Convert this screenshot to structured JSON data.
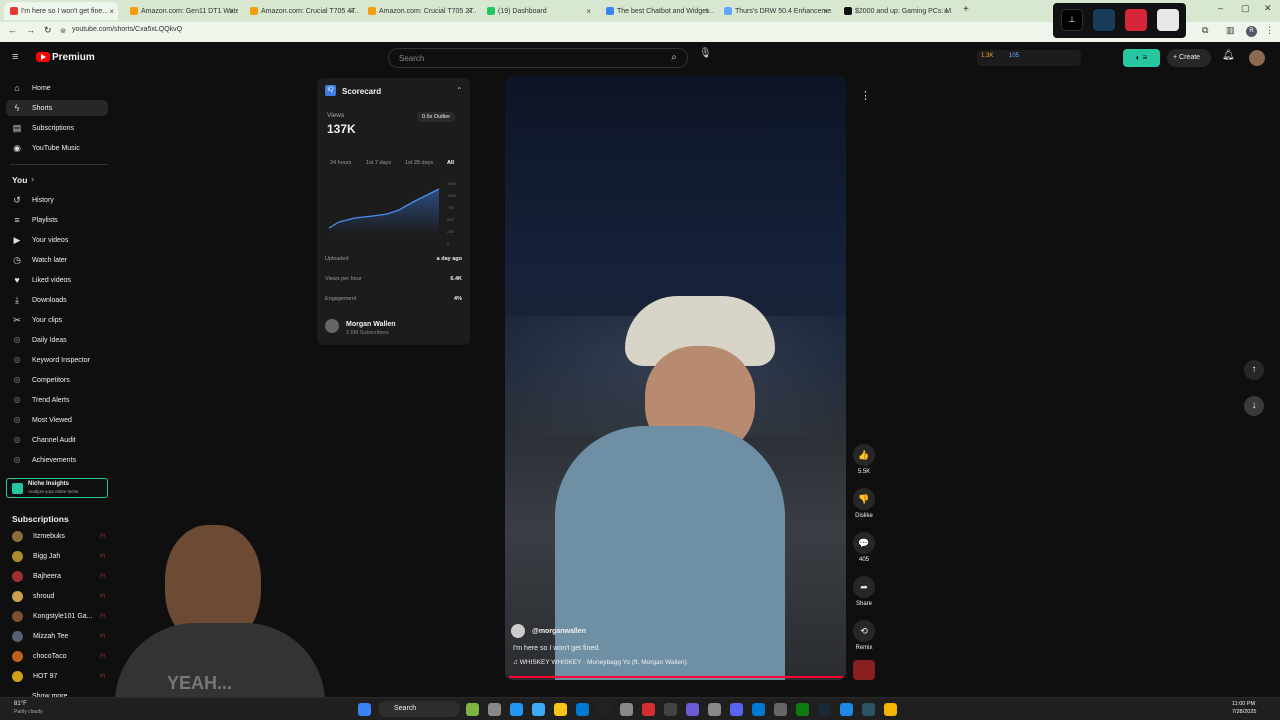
{
  "browser": {
    "tabs": [
      {
        "title": "I'm here so I won't get fine...",
        "color": "#e53935"
      },
      {
        "title": "Amazon.com: Gen11 DT1 Wate...",
        "color": "#f59e0b"
      },
      {
        "title": "Amazon.com: Crucial T705 4T...",
        "color": "#f59e0b"
      },
      {
        "title": "Amazon.com: Crucial T705 2T...",
        "color": "#f59e0b"
      },
      {
        "title": "(19) Dashboard",
        "color": "#22c55e"
      },
      {
        "title": "The best Chatbot and Widget...",
        "color": "#3b82f6"
      },
      {
        "title": "Thurs's DRW 50.4 Enhanceme...",
        "color": "#60a5fa"
      },
      {
        "title": "$2000 and up: Gaming PCs: M...",
        "color": "#111111"
      }
    ],
    "url": "youtube.com/shorts/Cxa5xLQQkvQ"
  },
  "header": {
    "logo_text": "Premium",
    "search_placeholder": "Search",
    "stats": [
      "1.3K",
      "105"
    ],
    "create_label": "Create"
  },
  "sidebar": {
    "main": [
      {
        "label": "Home",
        "icon": "home-icon",
        "glyph": "⌂"
      },
      {
        "label": "Shorts",
        "icon": "shorts-icon",
        "glyph": "ϟ"
      },
      {
        "label": "Subscriptions",
        "icon": "subscriptions-icon",
        "glyph": "▤"
      },
      {
        "label": "YouTube Music",
        "icon": "music-icon",
        "glyph": "◉"
      }
    ],
    "you_label": "You",
    "you_items": [
      {
        "label": "History",
        "glyph": "↺"
      },
      {
        "label": "Playlists",
        "glyph": "≡"
      },
      {
        "label": "Your videos",
        "glyph": "▶"
      },
      {
        "label": "Watch later",
        "glyph": "◷"
      },
      {
        "label": "Liked videos",
        "glyph": "♥"
      },
      {
        "label": "Downloads",
        "glyph": "⤓"
      },
      {
        "label": "Your clips",
        "glyph": "✂"
      }
    ],
    "tools": [
      "Daily Ideas",
      "Keyword Inspector",
      "Competitors",
      "Trend Alerts",
      "Most Viewed",
      "Channel Audit",
      "Achievements"
    ],
    "niche": {
      "title": "Niche Insights",
      "sub": "Analyze your entire niche"
    },
    "subs_label": "Subscriptions",
    "subs": [
      {
        "name": "Itzmebuks",
        "color": "#8a6d3b"
      },
      {
        "name": "Bigg Jah",
        "color": "#b08a2e"
      },
      {
        "name": "Bajheera",
        "color": "#a03030"
      },
      {
        "name": "shroud",
        "color": "#c8a050"
      },
      {
        "name": "Kongstyle101 Ga...",
        "color": "#7a5030"
      },
      {
        "name": "Mizzah Tee",
        "color": "#556070"
      },
      {
        "name": "chocoTaco",
        "color": "#c06020"
      },
      {
        "name": "HOT 97",
        "color": "#d4a017"
      }
    ],
    "show_more": "Show more"
  },
  "scorecard": {
    "title": "Scorecard",
    "views_label": "Views",
    "views": "137K",
    "outlier": "0.6x Outlier",
    "ranges": [
      "24 hours",
      "1st 7 days",
      "1st 28 days",
      "All"
    ],
    "yticks": [
      "150K",
      "100K",
      "75K",
      "50K",
      "25K",
      "0"
    ],
    "rows": [
      {
        "label": "Uploaded",
        "value": "a day ago"
      },
      {
        "label": "Views per hour",
        "value": "6.4K"
      },
      {
        "label": "Engagement",
        "value": "4%"
      }
    ],
    "channel": {
      "name": "Morgan Wallen",
      "subs": "2.6M Subscribers"
    }
  },
  "video": {
    "channel": "@morganwallen",
    "caption": "I'm here so I won't get fined.",
    "sound": "WHISKEY WHISKEY · Moneybagg Yo (ft. Morgan Wallen)"
  },
  "actions": [
    {
      "label": "5.5K",
      "glyph": "👍",
      "name": "like-button"
    },
    {
      "label": "Dislike",
      "glyph": "👎",
      "name": "dislike-button"
    },
    {
      "label": "405",
      "glyph": "💬",
      "name": "comments-button"
    },
    {
      "label": "Share",
      "glyph": "➦",
      "name": "share-button"
    },
    {
      "label": "Remix",
      "glyph": "⟲",
      "name": "remix-button"
    }
  ],
  "taskbar": {
    "weather_temp": "81°F",
    "weather_desc": "Partly cloudy",
    "search": "Search",
    "time": "11:00 PM",
    "date": "7/28/2025"
  },
  "webcam_text": "YEAH..."
}
